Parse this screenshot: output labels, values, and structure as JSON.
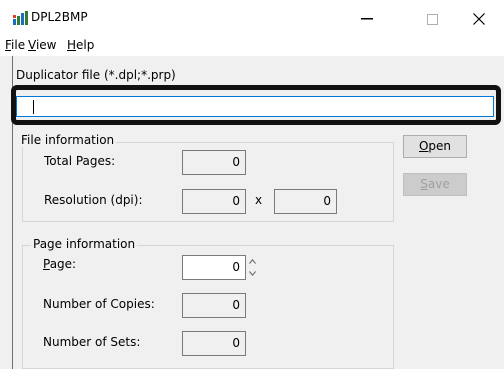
{
  "window": {
    "title": "DPL2BMP",
    "controls": {
      "minimize": "—",
      "maximize": "□",
      "close": "✕"
    }
  },
  "menu": {
    "items": [
      {
        "label_rest": "ile",
        "accel": "F"
      },
      {
        "label_rest": "iew",
        "accel": "V"
      },
      {
        "label_rest": "elp",
        "accel": "H"
      }
    ]
  },
  "duplicator": {
    "label": "Duplicator file (*.dpl;*.prp)",
    "value": ""
  },
  "file_info": {
    "title": "File information",
    "total_pages_label": "Total Pages:",
    "total_pages": "0",
    "resolution_label": "Resolution (dpi):",
    "resolution_x": "0",
    "resolution_sep": "x",
    "resolution_y": "0"
  },
  "page_info": {
    "title": "Page information",
    "page_label_accel": "P",
    "page_label_rest": "age:",
    "page": "0",
    "copies_label": "Number of Copies:",
    "copies": "0",
    "sets_label": "Number of Sets:",
    "sets": "0"
  },
  "buttons": {
    "open_accel": "O",
    "open_rest": "pen",
    "save_accel": "S",
    "save_rest": "ave"
  }
}
